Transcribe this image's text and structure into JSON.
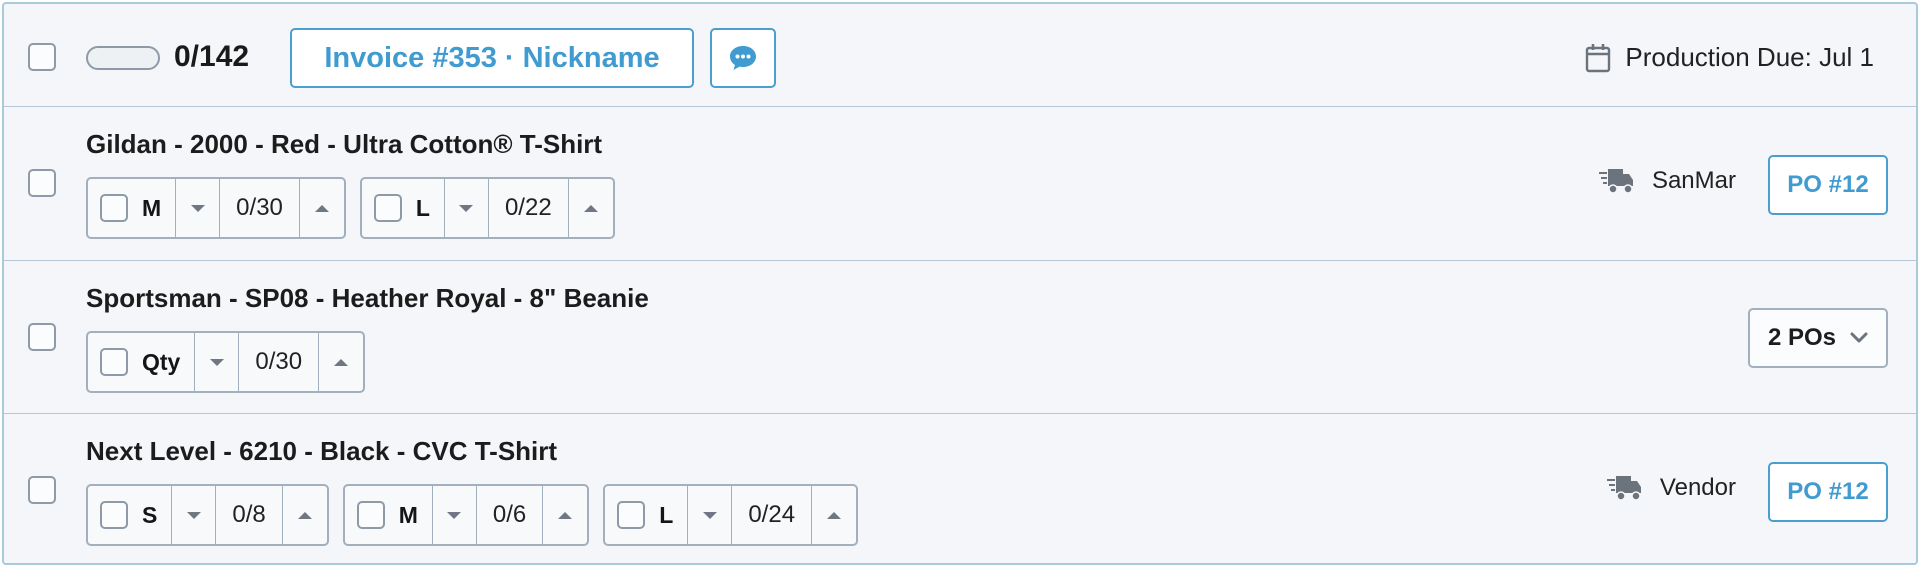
{
  "header": {
    "progress": {
      "fraction": 0,
      "count_label": "0/142"
    },
    "invoice_label": "Invoice #353 · Nickname",
    "production_due": "Production Due: Jul 1"
  },
  "items": [
    {
      "title": "Gildan - 2000 - Red - Ultra Cotton® T-Shirt",
      "sizes": [
        {
          "label": "M",
          "count": "0/30"
        },
        {
          "label": "L",
          "count": "0/22"
        }
      ],
      "vendor": "SanMar",
      "po_label": "PO #12"
    },
    {
      "title": "Sportsman - SP08 - Heather Royal - 8\" Beanie",
      "sizes": [
        {
          "label": "Qty",
          "count": "0/30"
        }
      ],
      "pos_label": "2 POs"
    },
    {
      "title": "Next Level - 6210 - Black - CVC T-Shirt",
      "sizes": [
        {
          "label": "S",
          "count": "0/8"
        },
        {
          "label": "M",
          "count": "0/6"
        },
        {
          "label": "L",
          "count": "0/24"
        }
      ],
      "vendor": "Vendor",
      "po_label": "PO #12"
    }
  ],
  "icons": {
    "comment": "chat-bubble-icon",
    "calendar": "calendar-icon",
    "truck": "truck-icon",
    "chevron": "chevron-down-icon",
    "decrement": "caret-down-icon",
    "increment": "caret-up-icon"
  },
  "colors": {
    "accent": "#3f9bd0",
    "border": "#a2b0bd",
    "background": "#f4f6f9"
  }
}
